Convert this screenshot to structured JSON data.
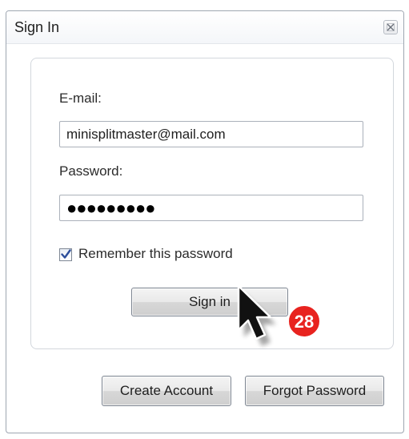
{
  "window": {
    "title": "Sign In"
  },
  "form": {
    "email_label": "E-mail:",
    "email_value": "minisplitmaster@mail.com",
    "password_label": "Password:",
    "password_value": "●●●●●●●●●",
    "remember_label": "Remember this password",
    "remember_checked": true,
    "sign_in_label": "Sign in"
  },
  "footer": {
    "create_account_label": "Create Account",
    "forgot_password_label": "Forgot Password"
  },
  "annotation": {
    "step_number": "28",
    "badge_color": "#e8231f"
  },
  "icons": {
    "close": "close-icon",
    "checkmark": "checkmark-icon",
    "cursor": "mouse-pointer-icon"
  }
}
